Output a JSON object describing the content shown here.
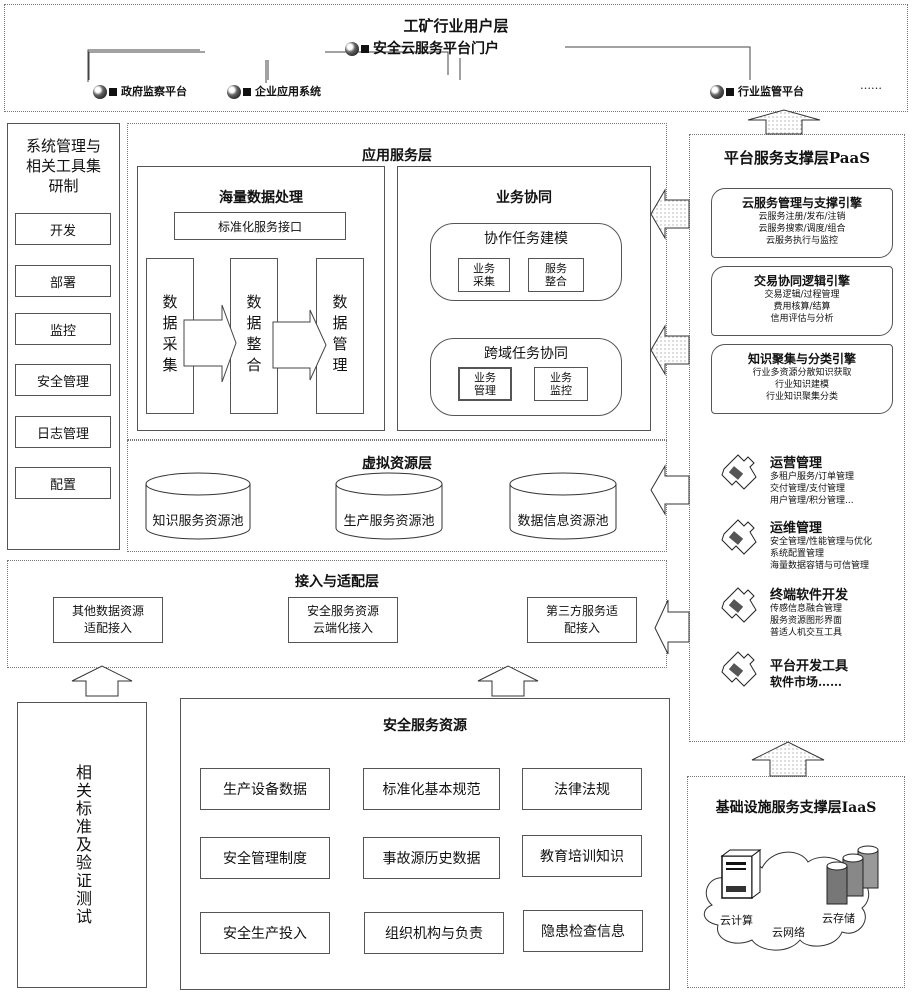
{
  "user_layer": {
    "title": "工矿行业用户层",
    "portal": "安全云服务平台门户",
    "nodes": [
      "政府监察平台",
      "企业应用系统",
      "行业监管平台"
    ],
    "ellipsis": "……"
  },
  "sys_mgmt": {
    "title_lines": [
      "系统管理与",
      "相关工具集",
      "研制"
    ],
    "items": [
      "开发",
      "部署",
      "监控",
      "安全管理",
      "日志管理",
      "配置"
    ]
  },
  "app_layer": {
    "title": "应用服务层",
    "mass_data": {
      "title": "海量数据处理",
      "interface": "标准化服务接口",
      "stages": [
        "数据采集",
        "数据整合",
        "数据管理"
      ]
    },
    "collab": {
      "title": "业务协同",
      "groups": [
        {
          "title": "协作任务建模",
          "items": [
            [
              "业务",
              "采集"
            ],
            [
              "服务",
              "整合"
            ]
          ]
        },
        {
          "title": "跨域任务协同",
          "items": [
            [
              "业务",
              "管理"
            ],
            [
              "业务",
              "监控"
            ]
          ]
        }
      ]
    }
  },
  "virtual_layer": {
    "title": "虚拟资源层",
    "pools": [
      "知识服务资源池",
      "生产服务资源池",
      "数据信息资源池"
    ]
  },
  "access_layer": {
    "title": "接入与适配层",
    "items": [
      [
        "其他数据资源",
        "适配接入"
      ],
      [
        "安全服务资源",
        "云端化接入"
      ],
      [
        "第三方服务适",
        "配接入"
      ]
    ]
  },
  "standards": {
    "title": "相关标准及验证测试"
  },
  "security_resources": {
    "title": "安全服务资源",
    "items": [
      "生产设备数据",
      "标准化基本规范",
      "法律法规",
      "安全管理制度",
      "事故源历史数据",
      "教育培训知识",
      "安全生产投入",
      "组织机构与负责",
      "隐患检查信息"
    ]
  },
  "paas": {
    "title": "平台服务支撑层PaaS",
    "engines": [
      {
        "title": "云服务管理与支撑引擎",
        "lines": [
          "云服务注册/发布/注销",
          "云服务搜索/调度/组合",
          "云服务执行与监控"
        ]
      },
      {
        "title": "交易协同逻辑引擎",
        "lines": [
          "交易逻辑/过程管理",
          "费用核算/结算",
          "信用评估与分析"
        ]
      },
      {
        "title": "知识聚集与分类引擎",
        "lines": [
          "行业多资源分散知识获取",
          "行业知识建模",
          "行业知识聚集分类"
        ]
      }
    ],
    "modules": [
      {
        "title": "运营管理",
        "lines": [
          "多租户服务/订单管理",
          "交付管理/支付管理",
          "用户管理/积分管理..."
        ]
      },
      {
        "title": "运维管理",
        "lines": [
          "安全管理/性能管理与优化",
          "系统配置管理",
          "海量数据容错与可信管理"
        ]
      },
      {
        "title": "终端软件开发",
        "lines": [
          "传感信息融合管理",
          "服务资源图形界面",
          "普适人机交互工具"
        ]
      },
      {
        "title": "平台开发工具",
        "lines": [
          "软件市场……"
        ]
      }
    ]
  },
  "iaas": {
    "title": "基础设施服务支撑层IaaS",
    "labels": {
      "compute": "云计算",
      "storage": "云存储",
      "network": "云网络"
    }
  }
}
